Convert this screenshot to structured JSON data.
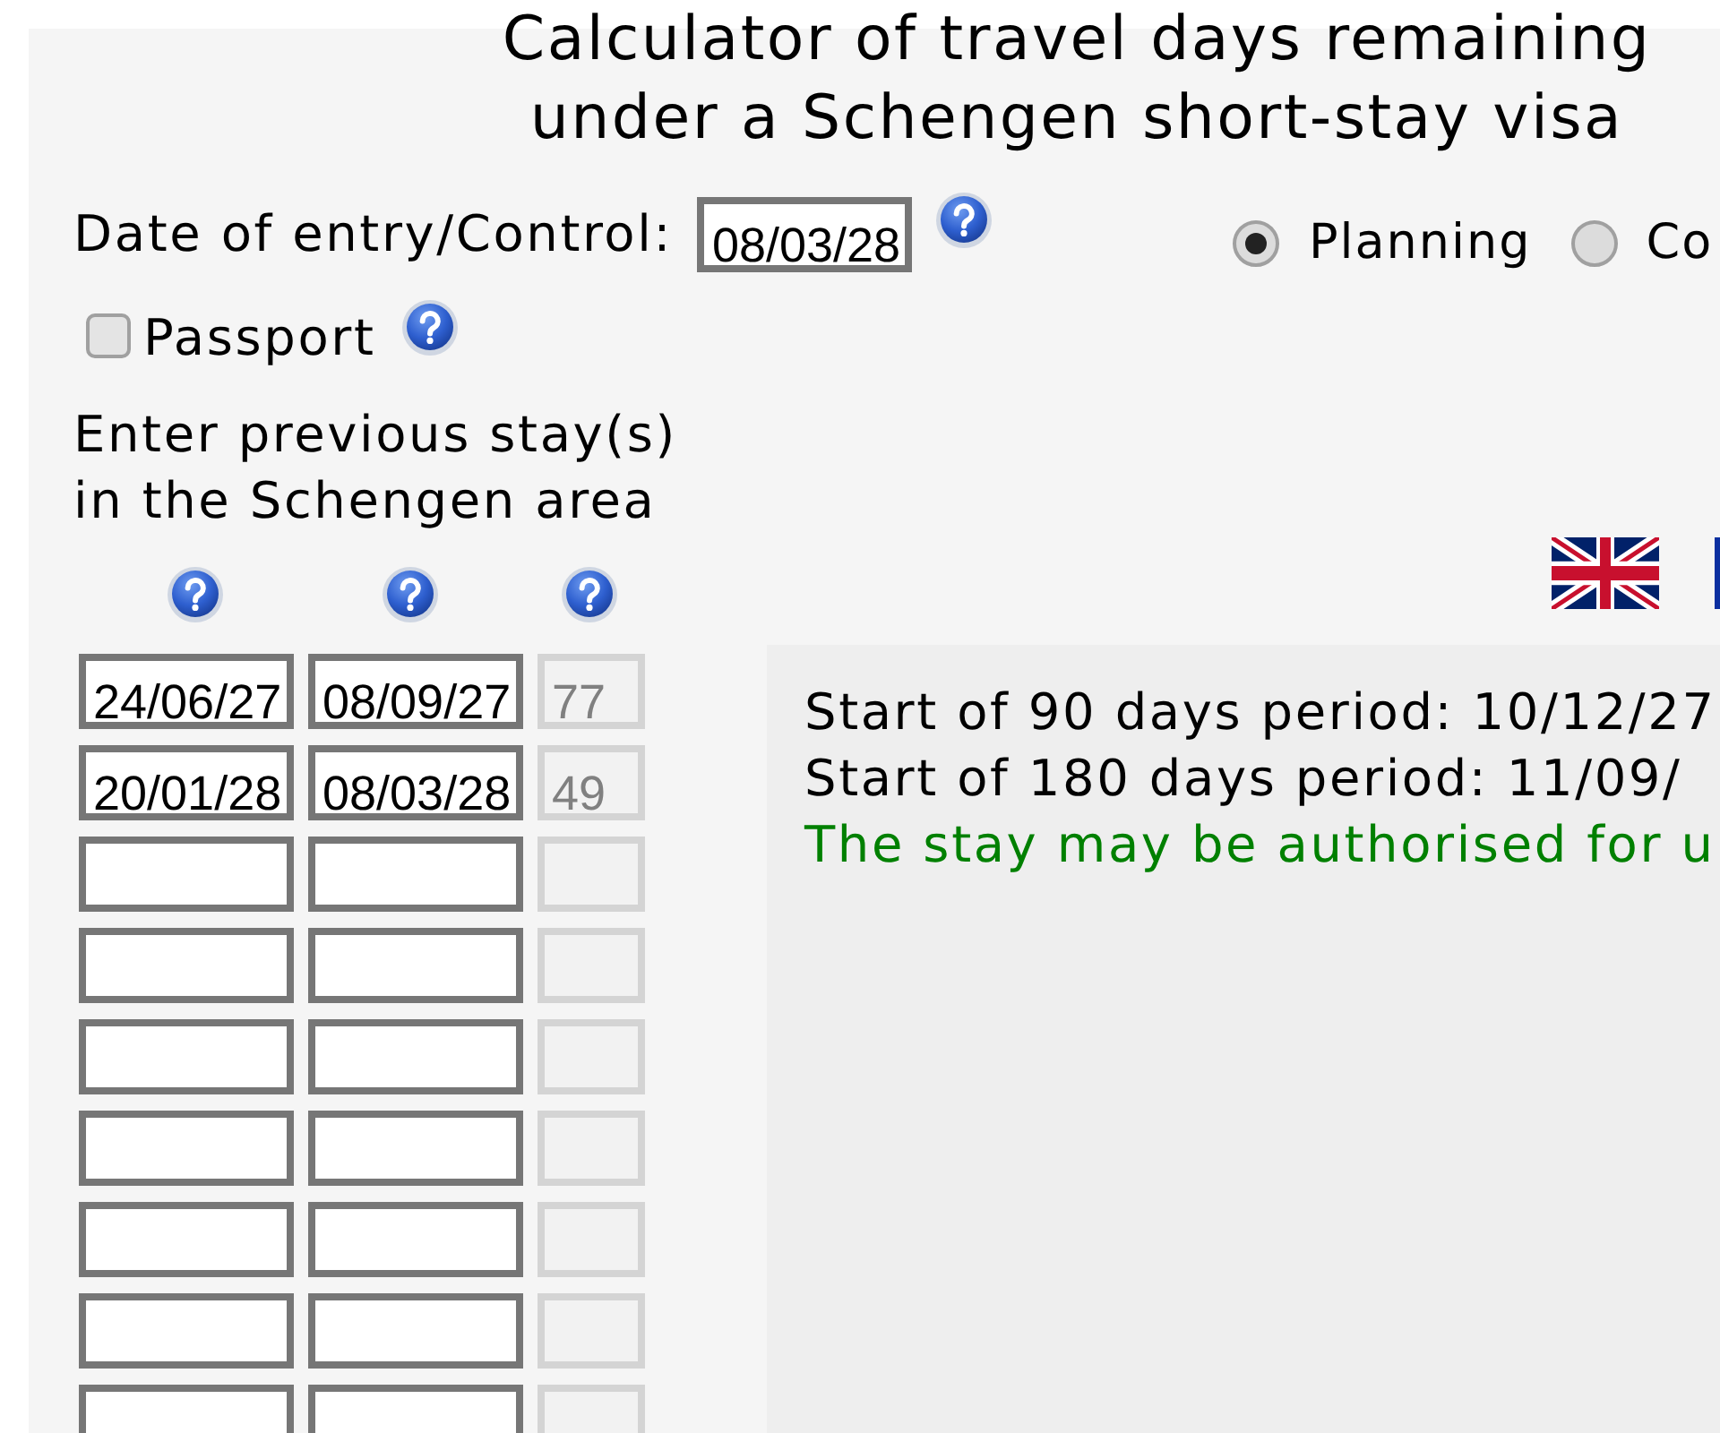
{
  "title": "Calculator of travel days remaining under a Schengen short-stay visa",
  "entry": {
    "label": "Date of entry/Control:",
    "value": "08/03/28"
  },
  "mode": [
    {
      "label": "Planning",
      "selected": true
    },
    {
      "label": "Co",
      "selected": false
    }
  ],
  "passport": {
    "label": "Passport",
    "checked": false
  },
  "stays": {
    "heading": "Enter previous stay(s) in the Schengen area",
    "rows": [
      {
        "start": "24/06/27",
        "end": "08/09/27",
        "days": "77"
      },
      {
        "start": "20/01/28",
        "end": "08/03/28",
        "days": "49"
      },
      {},
      {},
      {},
      {},
      {},
      {},
      {}
    ]
  },
  "result": {
    "lines": [
      {
        "kind": "info",
        "text": "Start of 90 days period: 10/12/27"
      },
      {
        "kind": "info",
        "text": "Start of 180 days period: 11/09/"
      },
      {
        "kind": "success",
        "text": "The stay may be authorised for u"
      }
    ]
  }
}
